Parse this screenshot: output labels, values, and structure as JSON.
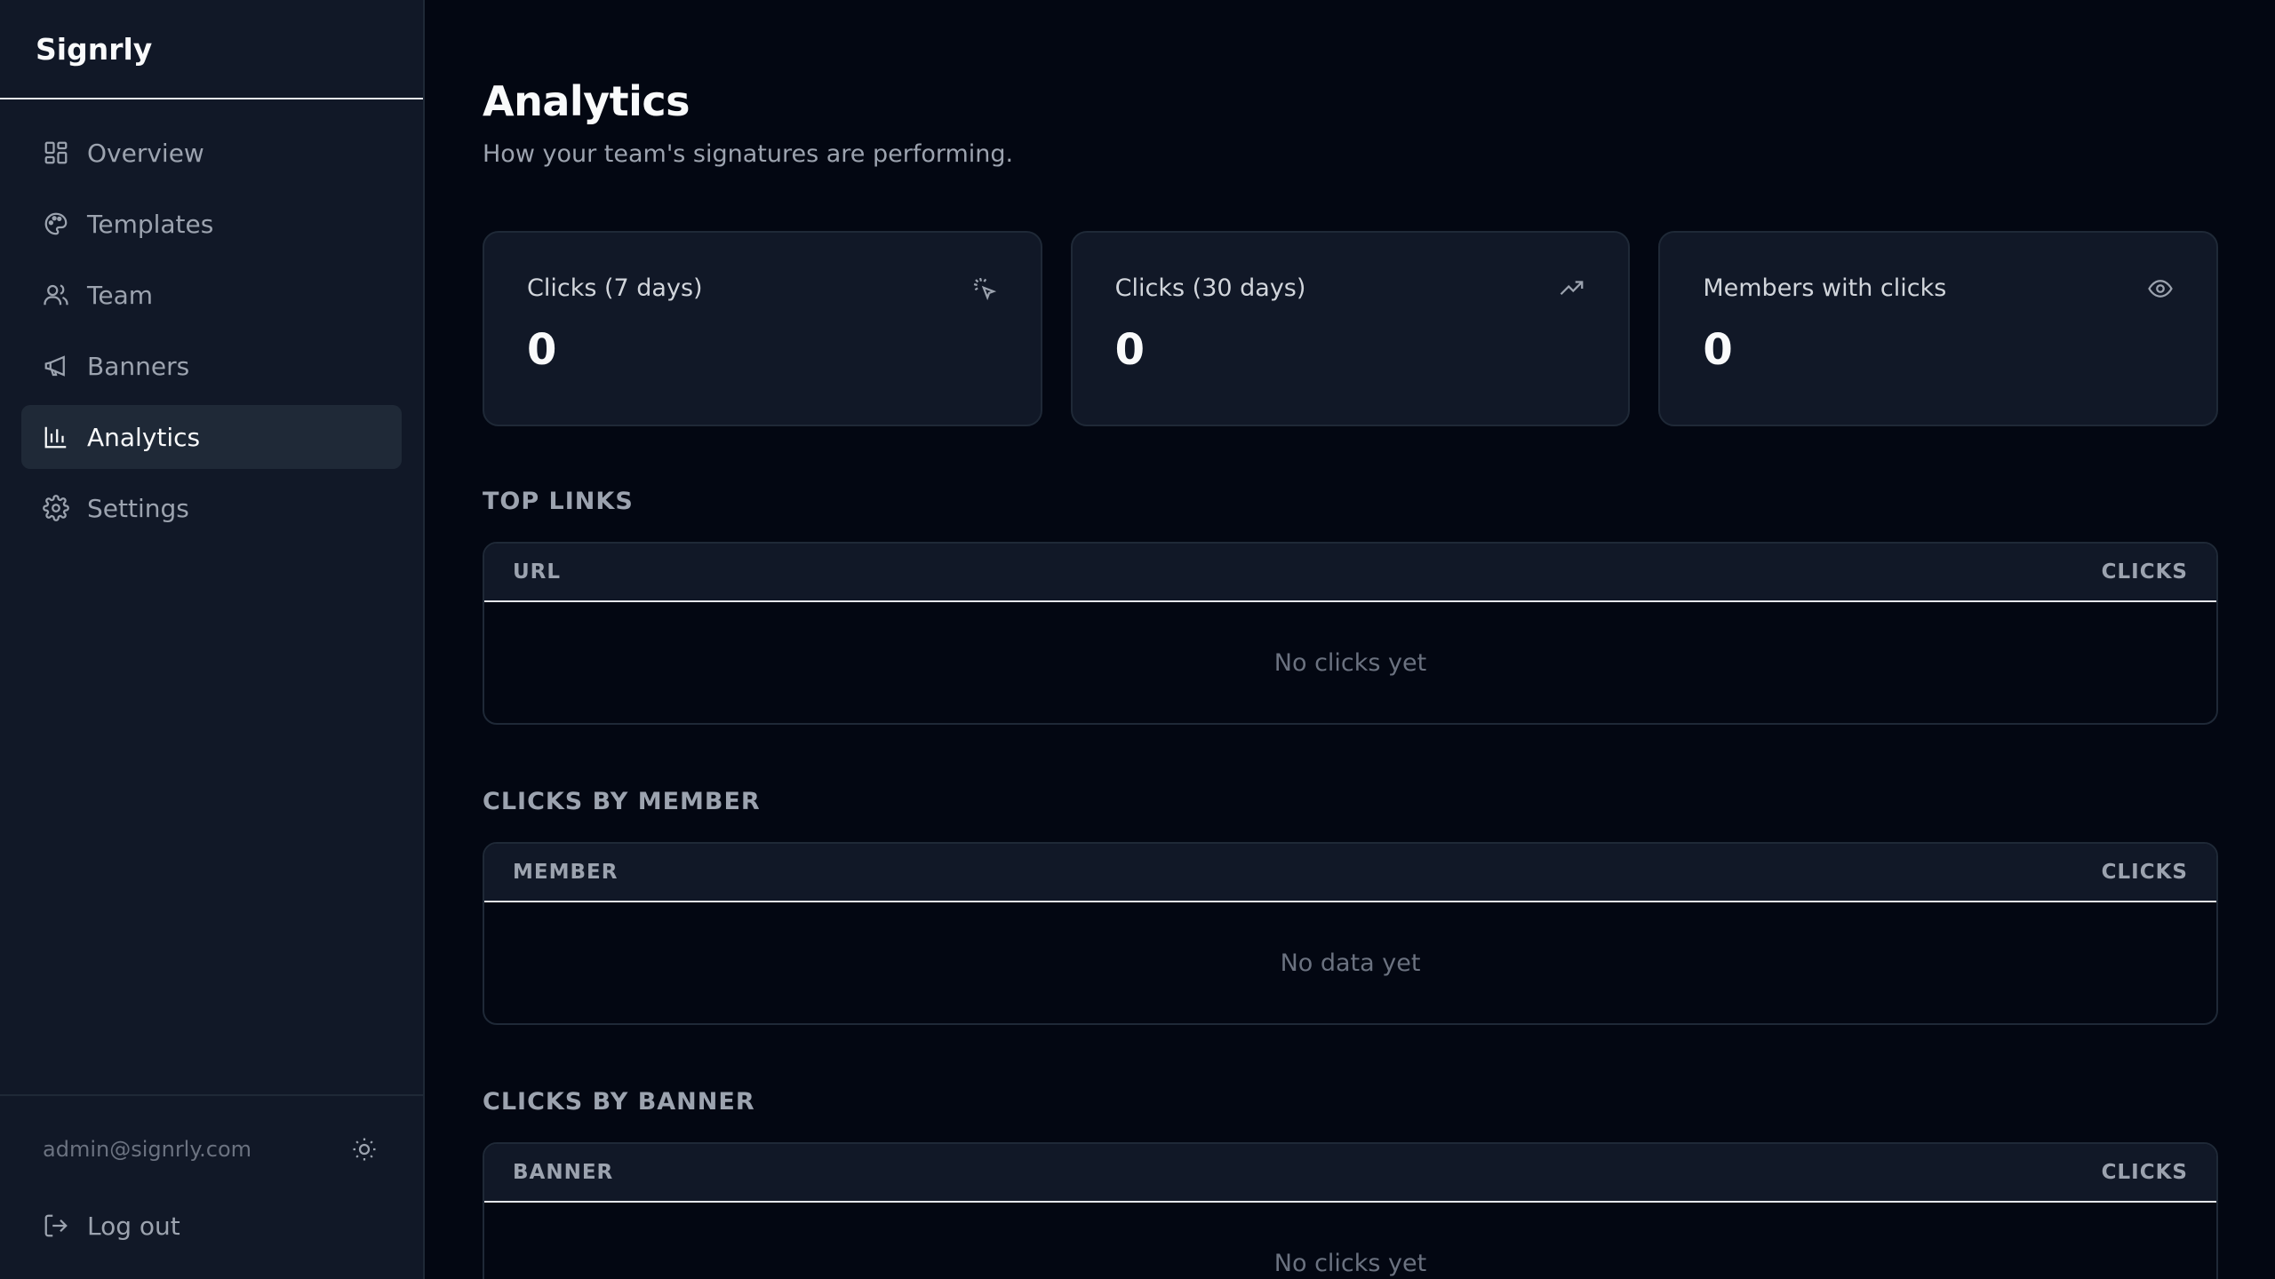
{
  "app": {
    "name": "Signrly"
  },
  "sidebar": {
    "items": [
      {
        "label": "Overview",
        "icon": "grid-icon",
        "active": false
      },
      {
        "label": "Templates",
        "icon": "palette-icon",
        "active": false
      },
      {
        "label": "Team",
        "icon": "users-icon",
        "active": false
      },
      {
        "label": "Banners",
        "icon": "megaphone-icon",
        "active": false
      },
      {
        "label": "Analytics",
        "icon": "bar-chart-icon",
        "active": true
      },
      {
        "label": "Settings",
        "icon": "gear-icon",
        "active": false
      }
    ],
    "user_email": "admin@signrly.com",
    "logout_label": "Log out"
  },
  "page": {
    "title": "Analytics",
    "subtitle": "How your team's signatures are performing."
  },
  "stats": [
    {
      "label": "Clicks (7 days)",
      "value": "0",
      "icon": "pointer-click-icon"
    },
    {
      "label": "Clicks (30 days)",
      "value": "0",
      "icon": "trending-up-icon"
    },
    {
      "label": "Members with clicks",
      "value": "0",
      "icon": "eye-icon"
    }
  ],
  "sections": [
    {
      "title": "TOP LINKS",
      "col1": "URL",
      "col2": "CLICKS",
      "empty": "No clicks yet"
    },
    {
      "title": "CLICKS BY MEMBER",
      "col1": "MEMBER",
      "col2": "CLICKS",
      "empty": "No data yet"
    },
    {
      "title": "CLICKS BY BANNER",
      "col1": "BANNER",
      "col2": "CLICKS",
      "empty": "No clicks yet"
    }
  ],
  "colors": {
    "background": "#030712",
    "sidebar": "#111827",
    "active_item": "#1f2937",
    "muted_text": "#9ca3af"
  }
}
